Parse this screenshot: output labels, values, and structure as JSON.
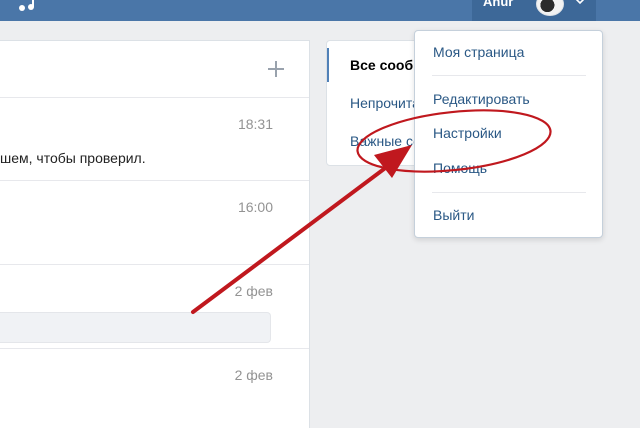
{
  "header": {
    "profile_name": "Anur"
  },
  "messages": {
    "dialogs": [
      {
        "time": "18:31",
        "text": "шем, чтобы проверил."
      },
      {
        "time": "16:00",
        "text": ""
      },
      {
        "time": "2 фев",
        "text": ""
      },
      {
        "time": "2 фев",
        "text": ""
      }
    ]
  },
  "filters": {
    "items": [
      "Все сообщения",
      "Непрочитанные",
      "Важные сообщения"
    ]
  },
  "profile_menu": {
    "items": [
      "Моя страница",
      "Редактировать",
      "Настройки",
      "Помощь",
      "Выйти"
    ]
  },
  "colors": {
    "header": "#4a76a8",
    "link": "#2a5885",
    "annotation": "#c0181e"
  }
}
